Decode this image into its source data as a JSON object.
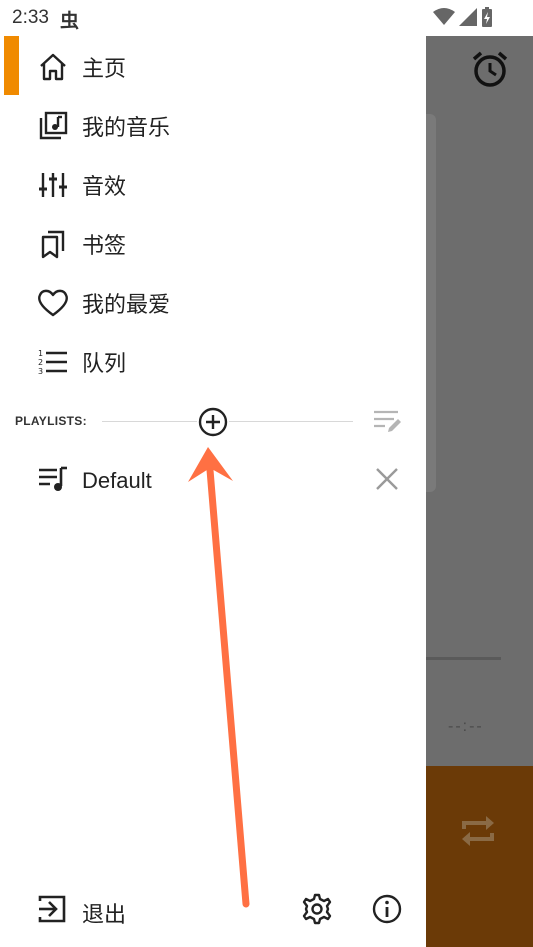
{
  "status_bar": {
    "time": "2:33",
    "app_glyph": "虫"
  },
  "drawer": {
    "accent_color": "#f08a00",
    "items": [
      {
        "label": "主页",
        "icon": "home-icon",
        "selected": true
      },
      {
        "label": "我的音乐",
        "icon": "music-library-icon"
      },
      {
        "label": "音效",
        "icon": "equalizer-icon"
      },
      {
        "label": "书签",
        "icon": "bookmark-icon"
      },
      {
        "label": "我的最爱",
        "icon": "heart-icon"
      },
      {
        "label": "队列",
        "icon": "queue-list-icon"
      }
    ],
    "playlists": {
      "title": "PLAYLISTS:",
      "items": [
        {
          "label": "Default",
          "icon": "playlist-icon"
        }
      ]
    },
    "footer": {
      "exit_label": "退出"
    }
  },
  "background_app": {
    "timecode": "--:--",
    "bottom_color": "#6b3a07"
  },
  "annotation": {
    "arrow_color": "#ff7043"
  }
}
